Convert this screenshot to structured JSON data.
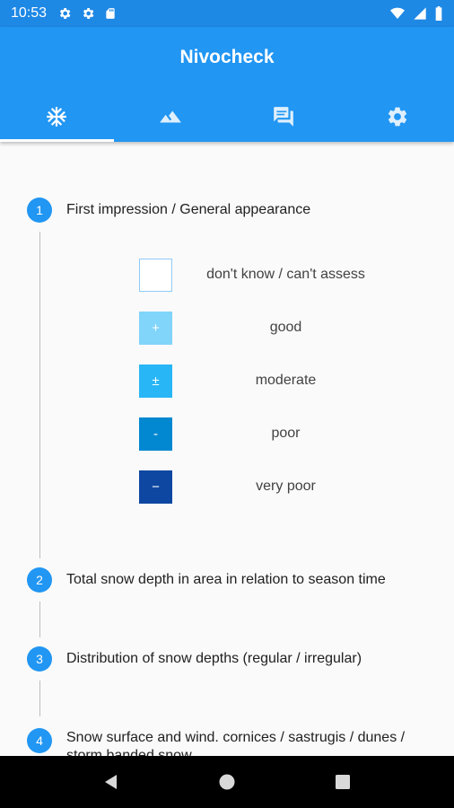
{
  "status_bar": {
    "time": "10:53",
    "icons": [
      "gear-icon",
      "gear-icon",
      "sd-card-icon",
      "wifi-icon",
      "signal-icon",
      "battery-icon"
    ]
  },
  "app_bar": {
    "title": "Nivocheck",
    "tabs": [
      {
        "icon": "snowflake-icon",
        "active": true
      },
      {
        "icon": "mountain-icon",
        "active": false
      },
      {
        "icon": "chat-icon",
        "active": false
      },
      {
        "icon": "settings-icon",
        "active": false
      }
    ]
  },
  "steps": [
    {
      "number": "1",
      "title": "First impression / General appearance"
    },
    {
      "number": "2",
      "title": "Total snow depth in area in relation to season time"
    },
    {
      "number": "3",
      "title": "Distribution of snow depths (regular / irregular)"
    },
    {
      "number": "4",
      "title": "Snow surface and wind. cornices / sastrugis / dunes / storm banded snow"
    }
  ],
  "options": [
    {
      "symbol": "",
      "label": "don't know / can't assess",
      "color": "#ffffff",
      "border": "#90caf9"
    },
    {
      "symbol": "+",
      "label": "good",
      "color": "#81d4fa",
      "border": "#81d4fa"
    },
    {
      "symbol": "±",
      "label": "moderate",
      "color": "#29b6f6",
      "border": "#29b6f6"
    },
    {
      "symbol": "-",
      "label": "poor",
      "color": "#0288d1",
      "border": "#0288d1"
    },
    {
      "symbol": "−",
      "label": "very poor",
      "color": "#0d47a1",
      "border": "#0d47a1"
    }
  ],
  "colors": {
    "primary": "#2196f3",
    "status_bar": "#1e88e5"
  }
}
